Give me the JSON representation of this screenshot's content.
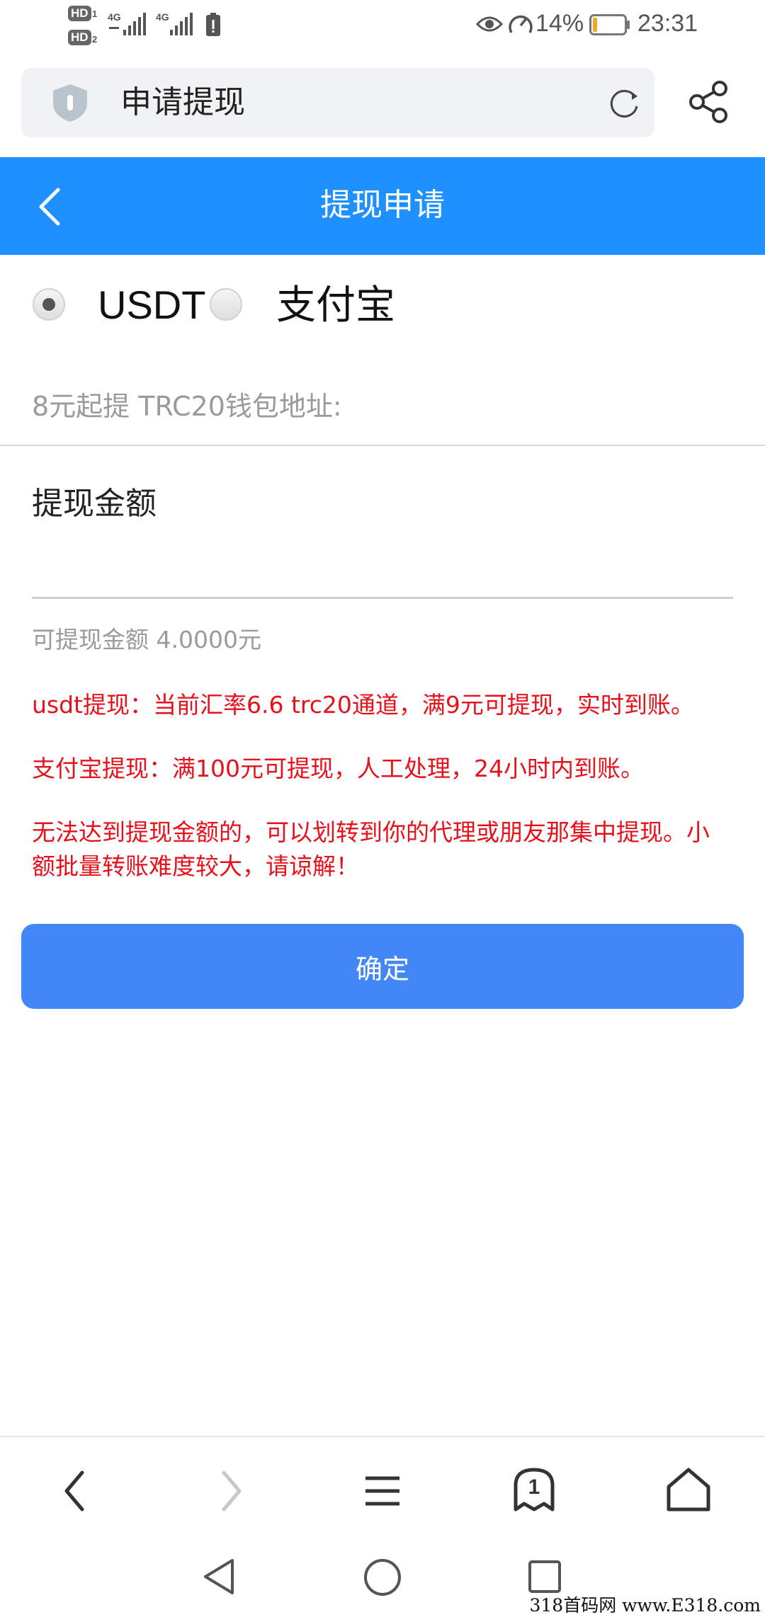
{
  "status_bar": {
    "sim1": "HD",
    "sim1_index": "1",
    "sim2": "HD",
    "sim2_index": "2",
    "net1": "4G",
    "net2": "4G",
    "battery_percent": "14%",
    "time": "23:31",
    "battery_level": 0.14,
    "battery_color": "#f5a623"
  },
  "browser": {
    "page_title": "申请提现",
    "shield_icon": "shield-icon",
    "refresh_icon": "refresh-icon",
    "share_icon": "share-icon"
  },
  "header": {
    "title": "提现申请",
    "back_icon": "chevron-left-icon",
    "color": "#1e90ff"
  },
  "method": {
    "selected": "USDT",
    "options": [
      {
        "label": "USDT",
        "checked": true
      },
      {
        "label": "支付宝",
        "checked": false
      }
    ]
  },
  "form": {
    "address_placeholder": "8元起提 TRC20钱包地址:",
    "address_value": "",
    "amount_label": "提现金额",
    "amount_value": ""
  },
  "info": {
    "available": "可提现金额 4.0000元",
    "notes": [
      "usdt提现：当前汇率6.6 trc20通道，满9元可提现，实时到账。",
      "支付宝提现：满100元可提现，人工处理，24小时内到账。",
      "无法达到提现金额的，可以划转到你的代理或朋友那集中提现。小额批量转账难度较大，请谅解！"
    ],
    "note_color": "#e8101a"
  },
  "confirm_button": {
    "label": "确定",
    "color": "#4287f5"
  },
  "bottom_nav": {
    "tab_count": "1",
    "icons": [
      "back-icon",
      "forward-icon",
      "menu-icon",
      "tabs-icon",
      "home-icon"
    ]
  },
  "system_nav": {
    "icons": [
      "triangle-back-icon",
      "circle-home-icon",
      "square-recents-icon"
    ]
  },
  "watermark": "318首码网 www.E318.com"
}
